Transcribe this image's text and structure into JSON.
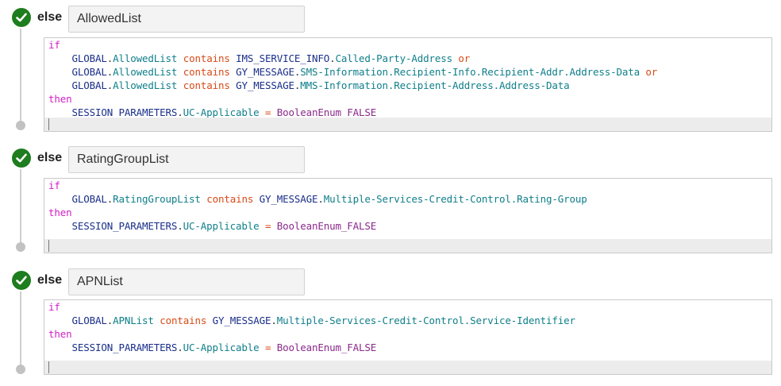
{
  "blocks": [
    {
      "keyword": "else",
      "name": "AllowedList",
      "lines": [
        [
          {
            "t": "if",
            "c": "k"
          }
        ],
        [
          {
            "t": "    ",
            "c": "p"
          },
          {
            "t": "GLOBAL",
            "c": "g"
          },
          {
            "t": ".",
            "c": "p"
          },
          {
            "t": "AllowedList",
            "c": "f"
          },
          {
            "t": " contains ",
            "c": "o"
          },
          {
            "t": "IMS_SERVICE_INFO",
            "c": "g"
          },
          {
            "t": ".",
            "c": "p"
          },
          {
            "t": "Called-Party-Address",
            "c": "f"
          },
          {
            "t": " or",
            "c": "o"
          }
        ],
        [
          {
            "t": "    ",
            "c": "p"
          },
          {
            "t": "GLOBAL",
            "c": "g"
          },
          {
            "t": ".",
            "c": "p"
          },
          {
            "t": "AllowedList",
            "c": "f"
          },
          {
            "t": " contains ",
            "c": "o"
          },
          {
            "t": "GY_MESSAGE",
            "c": "g"
          },
          {
            "t": ".",
            "c": "p"
          },
          {
            "t": "SMS-Information.Recipient-Info.Recipient-Addr.Address-Data",
            "c": "f"
          },
          {
            "t": " or",
            "c": "o"
          }
        ],
        [
          {
            "t": "    ",
            "c": "p"
          },
          {
            "t": "GLOBAL",
            "c": "g"
          },
          {
            "t": ".",
            "c": "p"
          },
          {
            "t": "AllowedList",
            "c": "f"
          },
          {
            "t": " contains ",
            "c": "o"
          },
          {
            "t": "GY_MESSAGE",
            "c": "g"
          },
          {
            "t": ".",
            "c": "p"
          },
          {
            "t": "MMS-Information.Recipient-Address.Address-Data",
            "c": "f"
          }
        ],
        [
          {
            "t": "then",
            "c": "k"
          }
        ],
        [
          {
            "t": "    ",
            "c": "p"
          },
          {
            "t": "SESSION_PARAMETERS",
            "c": "g"
          },
          {
            "t": ".",
            "c": "p"
          },
          {
            "t": "UC-Applicable",
            "c": "f"
          },
          {
            "t": " = ",
            "c": "o"
          },
          {
            "t": "BooleanEnum_FALSE",
            "c": "v"
          }
        ]
      ]
    },
    {
      "keyword": "else",
      "name": "RatingGroupList",
      "lines": [
        [
          {
            "t": "if",
            "c": "k"
          }
        ],
        [
          {
            "t": "    ",
            "c": "p"
          },
          {
            "t": "GLOBAL",
            "c": "g"
          },
          {
            "t": ".",
            "c": "p"
          },
          {
            "t": "RatingGroupList",
            "c": "f"
          },
          {
            "t": " contains ",
            "c": "o"
          },
          {
            "t": "GY_MESSAGE",
            "c": "g"
          },
          {
            "t": ".",
            "c": "p"
          },
          {
            "t": "Multiple-Services-Credit-Control.Rating-Group",
            "c": "f"
          }
        ],
        [
          {
            "t": "then",
            "c": "k"
          }
        ],
        [
          {
            "t": "    ",
            "c": "p"
          },
          {
            "t": "SESSION_PARAMETERS",
            "c": "g"
          },
          {
            "t": ".",
            "c": "p"
          },
          {
            "t": "UC-Applicable",
            "c": "f"
          },
          {
            "t": " = ",
            "c": "o"
          },
          {
            "t": "BooleanEnum_FALSE",
            "c": "v"
          }
        ]
      ]
    },
    {
      "keyword": "else",
      "name": "APNList",
      "lines": [
        [
          {
            "t": "if",
            "c": "k"
          }
        ],
        [
          {
            "t": "    ",
            "c": "p"
          },
          {
            "t": "GLOBAL",
            "c": "g"
          },
          {
            "t": ".",
            "c": "p"
          },
          {
            "t": "APNList",
            "c": "f"
          },
          {
            "t": " contains ",
            "c": "o"
          },
          {
            "t": "GY_MESSAGE",
            "c": "g"
          },
          {
            "t": ".",
            "c": "p"
          },
          {
            "t": "Multiple-Services-Credit-Control.Service-Identifier",
            "c": "f"
          }
        ],
        [
          {
            "t": "then",
            "c": "k"
          }
        ],
        [
          {
            "t": "    ",
            "c": "p"
          },
          {
            "t": "SESSION_PARAMETERS",
            "c": "g"
          },
          {
            "t": ".",
            "c": "p"
          },
          {
            "t": "UC-Applicable",
            "c": "f"
          },
          {
            "t": " = ",
            "c": "o"
          },
          {
            "t": "BooleanEnum_FALSE",
            "c": "v"
          }
        ]
      ]
    }
  ],
  "colors": {
    "check": "#1e7d1e",
    "keyword_if_then": "#d11fc3",
    "object": "#1a2f8a",
    "field": "#0f7f8a",
    "operator": "#d84a17",
    "value": "#8a2a8a"
  },
  "icons": {
    "status": "check-circle-icon",
    "timeline_end": "dot-icon"
  }
}
